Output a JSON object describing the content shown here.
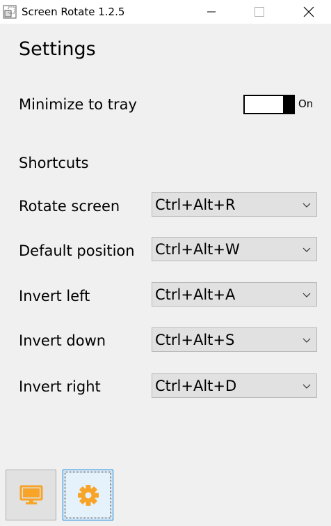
{
  "window": {
    "title": "Screen Rotate 1.2.5",
    "controls": [
      "minimize",
      "maximize",
      "close"
    ]
  },
  "page": {
    "title": "Settings"
  },
  "minimize_to_tray": {
    "label": "Minimize to tray",
    "state_label": "On",
    "enabled": true
  },
  "shortcuts": {
    "heading": "Shortcuts",
    "items": [
      {
        "label": "Rotate screen",
        "value": "Ctrl+Alt+R"
      },
      {
        "label": "Default position",
        "value": "Ctrl+Alt+W"
      },
      {
        "label": "Invert left",
        "value": "Ctrl+Alt+A"
      },
      {
        "label": "Invert down",
        "value": "Ctrl+Alt+S"
      },
      {
        "label": "Invert right",
        "value": "Ctrl+Alt+D"
      }
    ]
  },
  "nav": {
    "items": [
      {
        "icon": "monitor-icon",
        "selected": false
      },
      {
        "icon": "gear-icon",
        "selected": true
      }
    ]
  },
  "colors": {
    "accent": "#f7a428",
    "focus_border": "#0078d7",
    "selected_bg": "#e5f1fb",
    "background": "#f0f0f0"
  }
}
